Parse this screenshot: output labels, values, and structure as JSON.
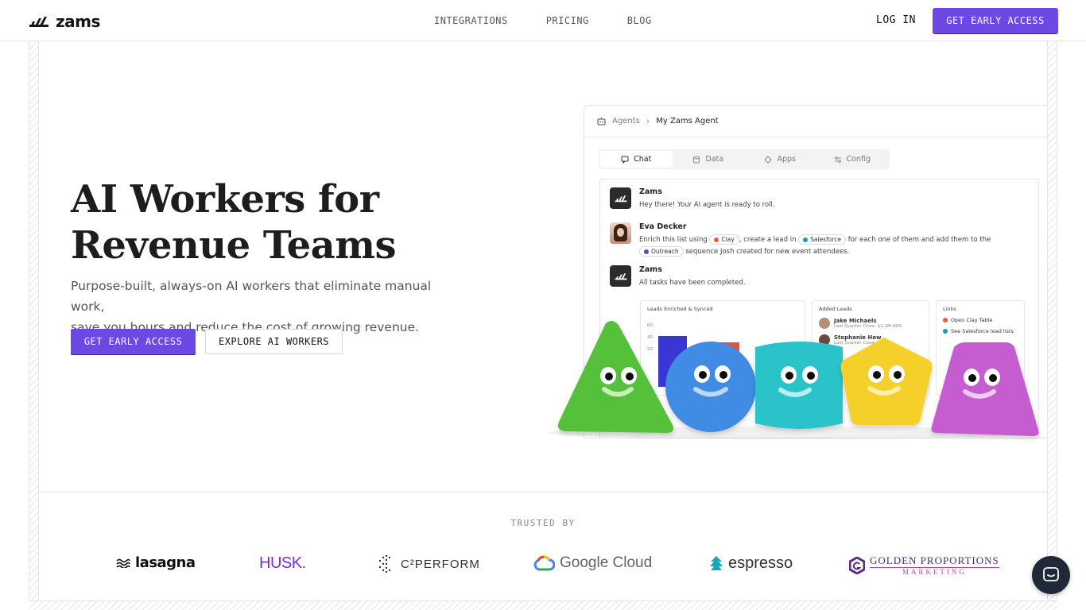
{
  "header": {
    "logo_text": "zams",
    "nav": [
      "INTEGRATIONS",
      "PRICING",
      "BLOG"
    ],
    "login": "LOG IN",
    "cta": "GET EARLY ACCESS"
  },
  "hero": {
    "title_line1": "AI Workers for",
    "title_line2": "Revenue Teams",
    "subtitle_line1": "Purpose-built, always-on AI workers that eliminate manual work,",
    "subtitle_line2": "save you hours and reduce the cost of growing revenue.",
    "primary_button": "GET EARLY ACCESS",
    "secondary_button": "EXPLORE AI WORKERS"
  },
  "app_preview": {
    "breadcrumb_root": "Agents",
    "breadcrumb_current": "My Zams Agent",
    "tabs": [
      "Chat",
      "Data",
      "Apps",
      "Config"
    ],
    "messages": [
      {
        "name": "Zams",
        "text": "Hey there! Your AI agent is ready to roll."
      },
      {
        "name": "Eva Decker",
        "text_a": "Enrich this list using",
        "chip_clay": "Clay",
        "text_b": ", create a lead in",
        "chip_salesforce": "Salesforce",
        "text_c": "for each one of them and add them to the",
        "chip_outreach": "Outreach",
        "text_d": "sequence Josh created for new event attendees."
      },
      {
        "name": "Zams",
        "text": "All tasks have been completed."
      }
    ],
    "panel_leads_synced": "Leads Enriched & Synced",
    "panel_added_leads": "Added Leads",
    "panel_links": "Links",
    "lead1_name": "Jake Michaels",
    "lead1_sub": "Last Quarter Close: $2.1M ARR",
    "lead2_name": "Stephanie Haw",
    "lead2_sub": "Last Quarter Close",
    "link1": "Open Clay Table",
    "link2": "See Salesforce lead lists",
    "axis": [
      "60",
      "40",
      "20"
    ]
  },
  "trusted": {
    "label": "TRUSTED BY",
    "logos": [
      "lasagna",
      "HUSK.",
      "C²PERFORM",
      "Google Cloud",
      "espresso",
      "GOLDEN PROPORTIONS",
      "MARKETING"
    ]
  },
  "colors": {
    "accent": "#6d48e5",
    "dark": "#1f2937"
  }
}
